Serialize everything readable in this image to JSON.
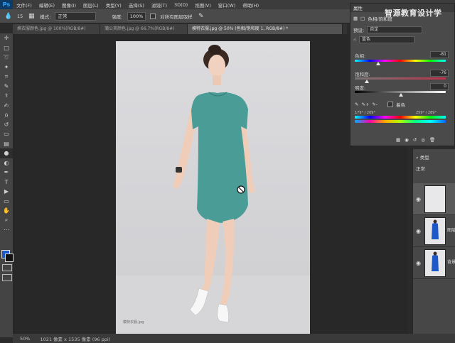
{
  "app": {
    "logo": "Ps"
  },
  "menu": [
    "文件(F)",
    "编辑(E)",
    "图像(I)",
    "图层(L)",
    "类型(Y)",
    "选择(S)",
    "滤镜(T)",
    "3D(D)",
    "视图(V)",
    "窗口(W)",
    "帮助(H)"
  ],
  "options": {
    "brush_size": "15",
    "mode_label": "模式:",
    "mode_value": "正常",
    "strength_label": "强度:",
    "strength_value": "100%",
    "sample_all_label": "对所有图层取样"
  },
  "tabs": [
    {
      "label": "换衣服颜色.jpg @ 100%(RGB/8#)",
      "active": false
    },
    {
      "label": "蒲公英颜色.jpg @ 66.7%(RGB/8#)",
      "active": false
    },
    {
      "label": "模特衣服.jpg @ 50% (色相/饱和度 1, RGB/8#) *",
      "active": true
    }
  ],
  "status": {
    "zoom": "50%",
    "doc": "1021 像素 x 1535 像素 (96 ppi)"
  },
  "properties": {
    "title": "属性",
    "subtitle": "色相/饱和度",
    "preset_label": "预设:",
    "preset_value": "自定",
    "channel_value": "蓝色",
    "hue_label": "色相:",
    "hue_value": "-81",
    "saturation_label": "饱和度:",
    "saturation_value": "-76",
    "lightness_label": "明度:",
    "lightness_value": "0",
    "colorize_label": "着色",
    "range_left": "179° / 209°",
    "range_right": "259° / 289°"
  },
  "watermark": "智源教育设计学",
  "layers": {
    "filter_label": "类型",
    "blend_mode": "正常",
    "rows": [
      {
        "name": ""
      },
      {
        "name": "图层"
      },
      {
        "name": "背景"
      }
    ]
  },
  "colors": {
    "dress": "#4a9d97",
    "foreground": "#1c58c8",
    "background_swatch": "#111111"
  },
  "photo_caption": "模特衣服.jpg"
}
